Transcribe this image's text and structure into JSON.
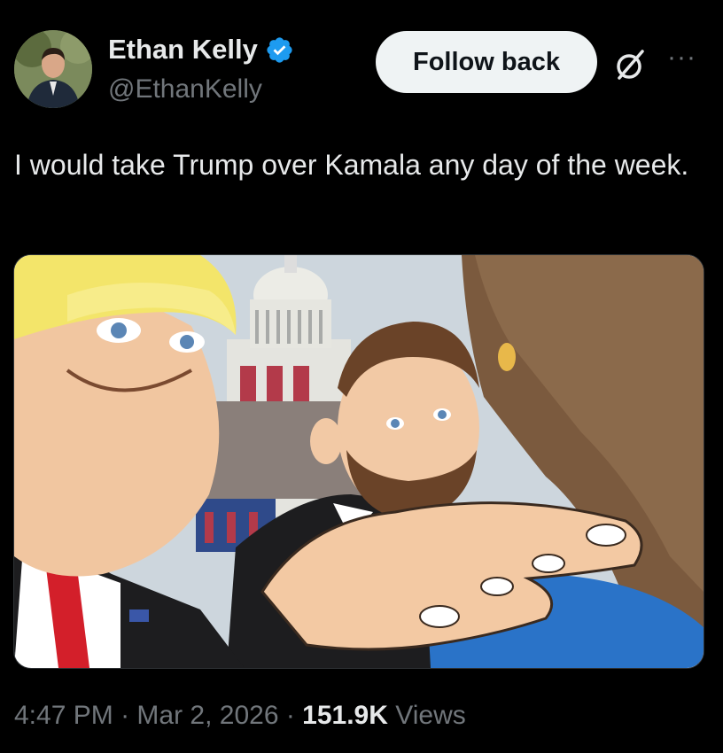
{
  "author": {
    "name": "Ethan Kelly",
    "handle": "@EthanKelly",
    "verified": true,
    "badge_color": "#1d9bf0"
  },
  "actions": {
    "follow_label": "Follow back",
    "grok_icon": "grok-icon",
    "more_label": "···"
  },
  "tweet": {
    "text": "I would take Trump over Kamala any day of the week.",
    "media_alt": "cartoon-illustration"
  },
  "meta": {
    "time": "4:47 PM",
    "sep1": " · ",
    "date": "Mar 2, 2026",
    "sep2": " · ",
    "views_count": "151.9K",
    "views_label": " Views"
  }
}
